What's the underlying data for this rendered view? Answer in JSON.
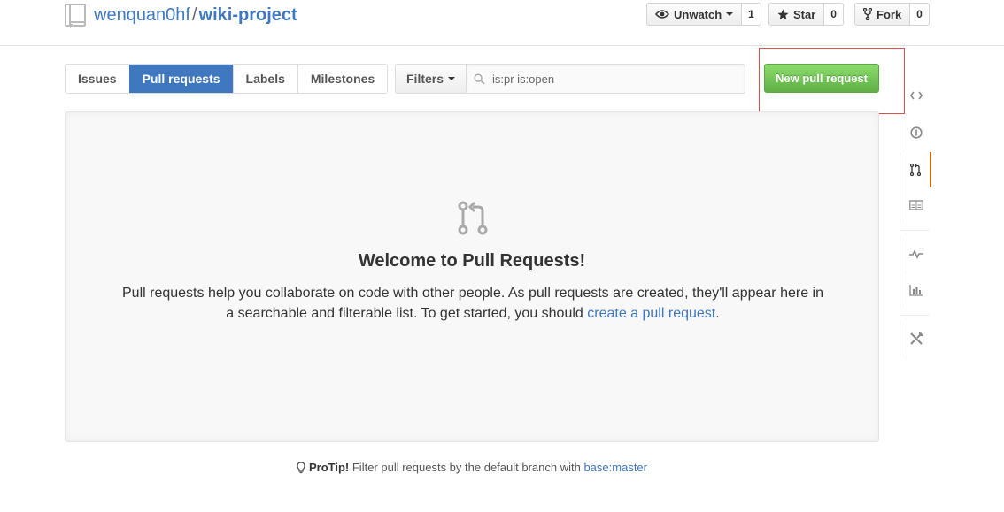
{
  "header": {
    "owner": "wenquan0hf",
    "separator": "/",
    "repo": "wiki-project",
    "unwatch_label": "Unwatch",
    "unwatch_count": "1",
    "star_label": "Star",
    "star_count": "0",
    "fork_label": "Fork",
    "fork_count": "0"
  },
  "subnav": {
    "tabs": [
      {
        "label": "Issues",
        "selected": false
      },
      {
        "label": "Pull requests",
        "selected": true
      },
      {
        "label": "Labels",
        "selected": false
      },
      {
        "label": "Milestones",
        "selected": false
      }
    ],
    "filters_label": "Filters",
    "search_value": "is:pr is:open",
    "new_pr_label": "New pull request"
  },
  "blankslate": {
    "title": "Welcome to Pull Requests!",
    "text_line1": "Pull requests help you collaborate on code with other people. As pull requests are created, they'll appear here in",
    "text_line2_prefix": "a searchable and filterable list. To get started, you should ",
    "text_link": "create a pull request",
    "text_suffix": "."
  },
  "protip": {
    "label": "ProTip!",
    "text": " Filter pull requests by the default branch with ",
    "link": "base:master"
  },
  "sidebar": {
    "icons": [
      "code-icon",
      "issues-icon",
      "pull-request-icon",
      "wiki-icon",
      "pulse-icon",
      "graphs-icon",
      "settings-icon"
    ],
    "selected": "pull-request-icon"
  },
  "colors": {
    "link": "#4078c0",
    "selected_tab": "#4078c0",
    "new_pr_button": "#6cc644",
    "sidebar_selected": "#d26911",
    "highlight_box": "#d9534f"
  }
}
